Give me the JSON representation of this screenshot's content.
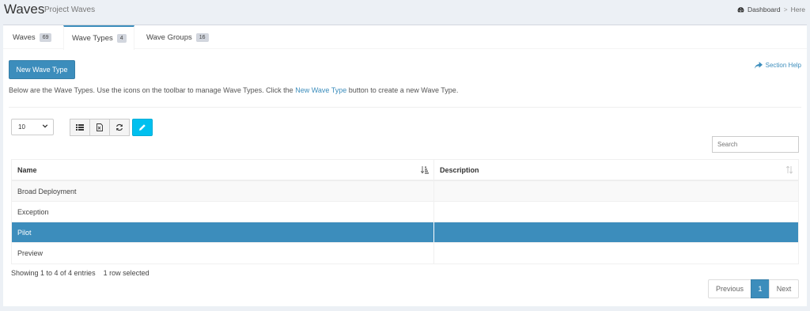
{
  "header": {
    "title": "Waves",
    "subtitle": "Project Waves",
    "breadcrumb": {
      "dashboard": "Dashboard",
      "separator": ">",
      "current": "Here"
    }
  },
  "tabs": [
    {
      "label": "Waves",
      "count": "69"
    },
    {
      "label": "Wave Types",
      "count": "4"
    },
    {
      "label": "Wave Groups",
      "count": "16"
    }
  ],
  "actions": {
    "new_label": "New Wave Type",
    "help_label": "Section Help"
  },
  "description": {
    "before": "Below are the Wave Types. Use the icons on the toolbar to manage Wave Types. Click the ",
    "link": "New Wave Type",
    "after": " button to create a new Wave Type."
  },
  "controls": {
    "page_length": "10",
    "search_placeholder": "Search"
  },
  "table": {
    "headers": [
      "Name",
      "Description"
    ],
    "rows": [
      {
        "name": "Broad Deployment",
        "description": ""
      },
      {
        "name": "Exception",
        "description": ""
      },
      {
        "name": "Pilot",
        "description": ""
      },
      {
        "name": "Preview",
        "description": ""
      }
    ]
  },
  "footer": {
    "info": "Showing 1 to 4 of 4 entries",
    "selected": "1 row selected",
    "pagination": {
      "prev": "Previous",
      "current": "1",
      "next": "Next"
    }
  },
  "colors": {
    "primary": "#3c8dbc",
    "info": "#00c0ef",
    "background": "#ecf0f5"
  }
}
